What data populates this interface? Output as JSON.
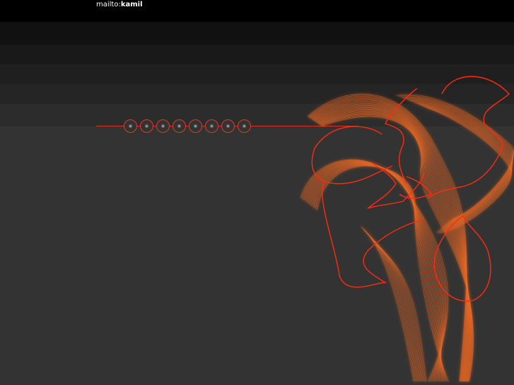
{
  "header": {
    "mailto_prefix": "mailto:",
    "mailto_name": "kamil"
  },
  "nav": {
    "dot_count": 8
  },
  "colors": {
    "background": "#333333",
    "header": "#000000",
    "accent": "#e23a1f",
    "curve": "#f06a25"
  }
}
